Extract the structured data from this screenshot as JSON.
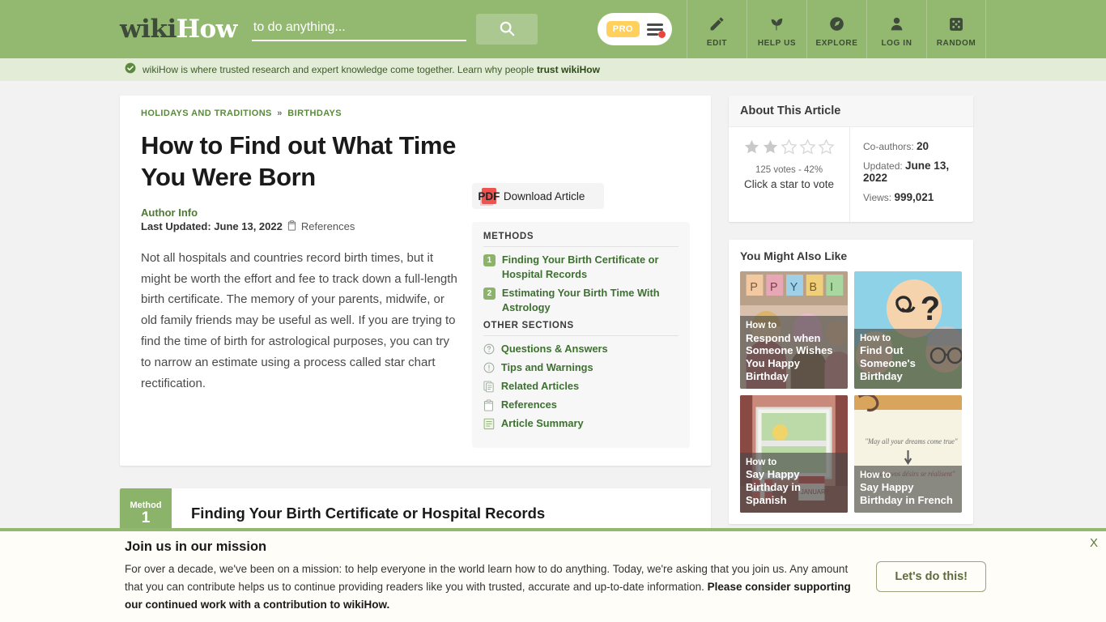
{
  "header": {
    "logo_wiki": "wiki",
    "logo_how": "How",
    "search_placeholder": "to do anything...",
    "search_value": "",
    "search_icon": "search-icon",
    "pro_label": "PRO",
    "nav": [
      {
        "label": "EDIT",
        "icon": "pencil-icon"
      },
      {
        "label": "HELP US",
        "icon": "sprout-icon"
      },
      {
        "label": "EXPLORE",
        "icon": "compass-icon"
      },
      {
        "label": "LOG IN",
        "icon": "user-icon"
      },
      {
        "label": "RANDOM",
        "icon": "dice-icon"
      }
    ]
  },
  "trustbar": {
    "icon": "verified-check-icon",
    "text": "wikiHow is where trusted research and expert knowledge come together. Learn why people ",
    "link": "trust wikiHow"
  },
  "article": {
    "breadcrumb": [
      {
        "label": "HOLIDAYS AND TRADITIONS"
      },
      {
        "label": "BIRTHDAYS"
      }
    ],
    "breadcrumb_separator": "»",
    "title": "How to Find out What Time You Were Born",
    "author_info": "Author Info",
    "last_updated_label": "Last Updated: June 13, 2022",
    "references_label": "References",
    "references_icon": "references-icon",
    "intro": "Not all hospitals and countries record birth times, but it might be worth the effort and fee to track down a full-length birth certificate. The memory of your parents, midwife, or old family friends may be useful as well. If you are trying to find the time of birth for astrological purposes, you can try to narrow an estimate using a process called star chart rectification.",
    "download_label": "Download Article",
    "download_icon": "pdf-icon",
    "pdf_badge": "PDF"
  },
  "toc": {
    "methods_heading": "METHODS",
    "methods": [
      {
        "num": "1",
        "label": "Finding Your Birth Certificate or Hospital Records"
      },
      {
        "num": "2",
        "label": "Estimating Your Birth Time With Astrology"
      }
    ],
    "other_heading": "OTHER SECTIONS",
    "other": [
      {
        "label": "Questions & Answers",
        "icon": "question-circle-icon"
      },
      {
        "label": "Tips and Warnings",
        "icon": "exclamation-circle-icon"
      },
      {
        "label": "Related Articles",
        "icon": "pages-icon"
      },
      {
        "label": "References",
        "icon": "clipboard-icon"
      },
      {
        "label": "Article Summary",
        "icon": "summary-icon"
      }
    ]
  },
  "method_section": {
    "badge_word": "Method",
    "badge_num": "1",
    "title": "Finding Your Birth Certificate or Hospital Records"
  },
  "about": {
    "heading": "About This Article",
    "stars_filled": 2,
    "stars_total": 5,
    "votes": "125 votes - 42%",
    "vote_cta": "Click a star to vote",
    "coauthors_label": "Co-authors:",
    "coauthors_value": "20",
    "updated_label": "Updated:",
    "updated_value": "June 13, 2022",
    "views_label": "Views:",
    "views_value": "999,021"
  },
  "you_might_also_like": {
    "heading": "You Might Also Like",
    "items": [
      {
        "prefix": "How to",
        "title": "Respond when Someone Wishes You Happy Birthday"
      },
      {
        "prefix": "How to",
        "title": "Find Out Someone's Birthday"
      },
      {
        "prefix": "How to",
        "title": "Say Happy Birthday in Spanish"
      },
      {
        "prefix": "How to",
        "title": "Say Happy Birthday in French"
      }
    ]
  },
  "bottom_banner": {
    "title": "Join us in our mission",
    "body_1": "For over a decade, we've been on a mission: to help everyone in the world learn how to do anything. Today, we're asking that you join us. Any amount that you can contribute helps us to continue providing readers like you with trusted, accurate and up-to-date information. ",
    "body_bold": "Please consider supporting our continued work with a contribution to wikiHow.",
    "button_label": "Let's do this!",
    "close_label": "X"
  },
  "colors": {
    "brand_green": "#93b970",
    "trust_green": "#e2ecd7",
    "link_green": "#3e7031",
    "badge_yellow": "#ffd15c",
    "pdf_red": "#ef5350"
  }
}
